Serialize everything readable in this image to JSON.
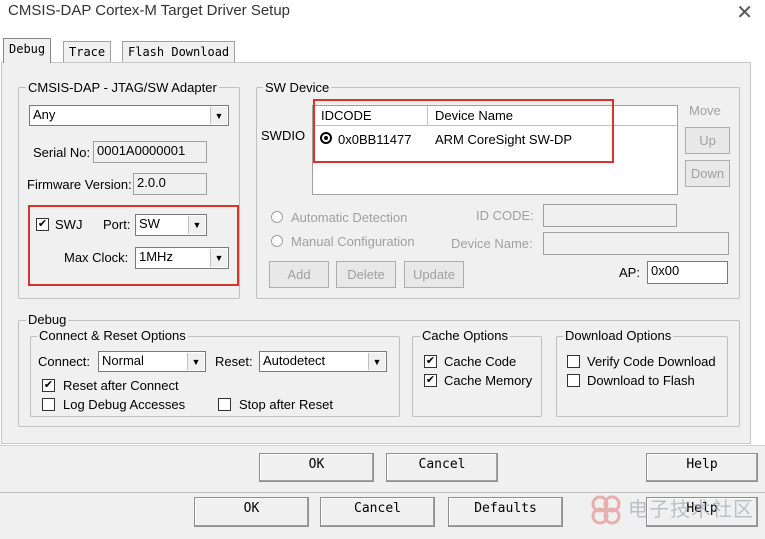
{
  "window": {
    "title": "CMSIS-DAP Cortex-M Target Driver Setup",
    "close_glyph": "✕"
  },
  "tabs": [
    "Debug",
    "Trace",
    "Flash Download"
  ],
  "adapter": {
    "legend": "CMSIS-DAP - JTAG/SW Adapter",
    "selected": "Any",
    "serial_label": "Serial No:",
    "serial_value": "0001A0000001",
    "firmware_label": "Firmware Version:",
    "firmware_value": "2.0.0",
    "swj_label": "SWJ",
    "swj_checked": true,
    "port_label": "Port:",
    "port_value": "SW",
    "maxclock_label": "Max Clock:",
    "maxclock_value": "1MHz"
  },
  "sw_device": {
    "legend": "SW Device",
    "swdio_label": "SWDIO",
    "col_idcode": "IDCODE",
    "col_device": "Device Name",
    "row_idcode": "0x0BB11477",
    "row_device": "ARM CoreSight SW-DP",
    "move_label": "Move",
    "up_label": "Up",
    "down_label": "Down",
    "auto_detect": "Automatic Detection",
    "manual_config": "Manual Configuration",
    "idcode_label": "ID CODE:",
    "devname_label": "Device Name:",
    "add": "Add",
    "delete": "Delete",
    "update": "Update",
    "ap_label": "AP:",
    "ap_value": "0x00"
  },
  "debug": {
    "legend": "Debug",
    "connect_reset_legend": "Connect & Reset Options",
    "connect_label": "Connect:",
    "connect_value": "Normal",
    "reset_label": "Reset:",
    "reset_value": "Autodetect",
    "reset_after_connect": "Reset after Connect",
    "log_debug": "Log Debug Accesses",
    "stop_after_reset": "Stop after Reset",
    "cache_legend": "Cache Options",
    "cache_code": "Cache Code",
    "cache_memory": "Cache Memory",
    "download_legend": "Download Options",
    "verify_download": "Verify Code Download",
    "download_flash": "Download to Flash"
  },
  "buttons_row1": {
    "ok": "OK",
    "cancel": "Cancel",
    "help": "Help"
  },
  "buttons_row2": {
    "ok": "OK",
    "cancel": "Cancel",
    "defaults": "Defaults",
    "help": "Help"
  },
  "watermark": "电子技术社区"
}
